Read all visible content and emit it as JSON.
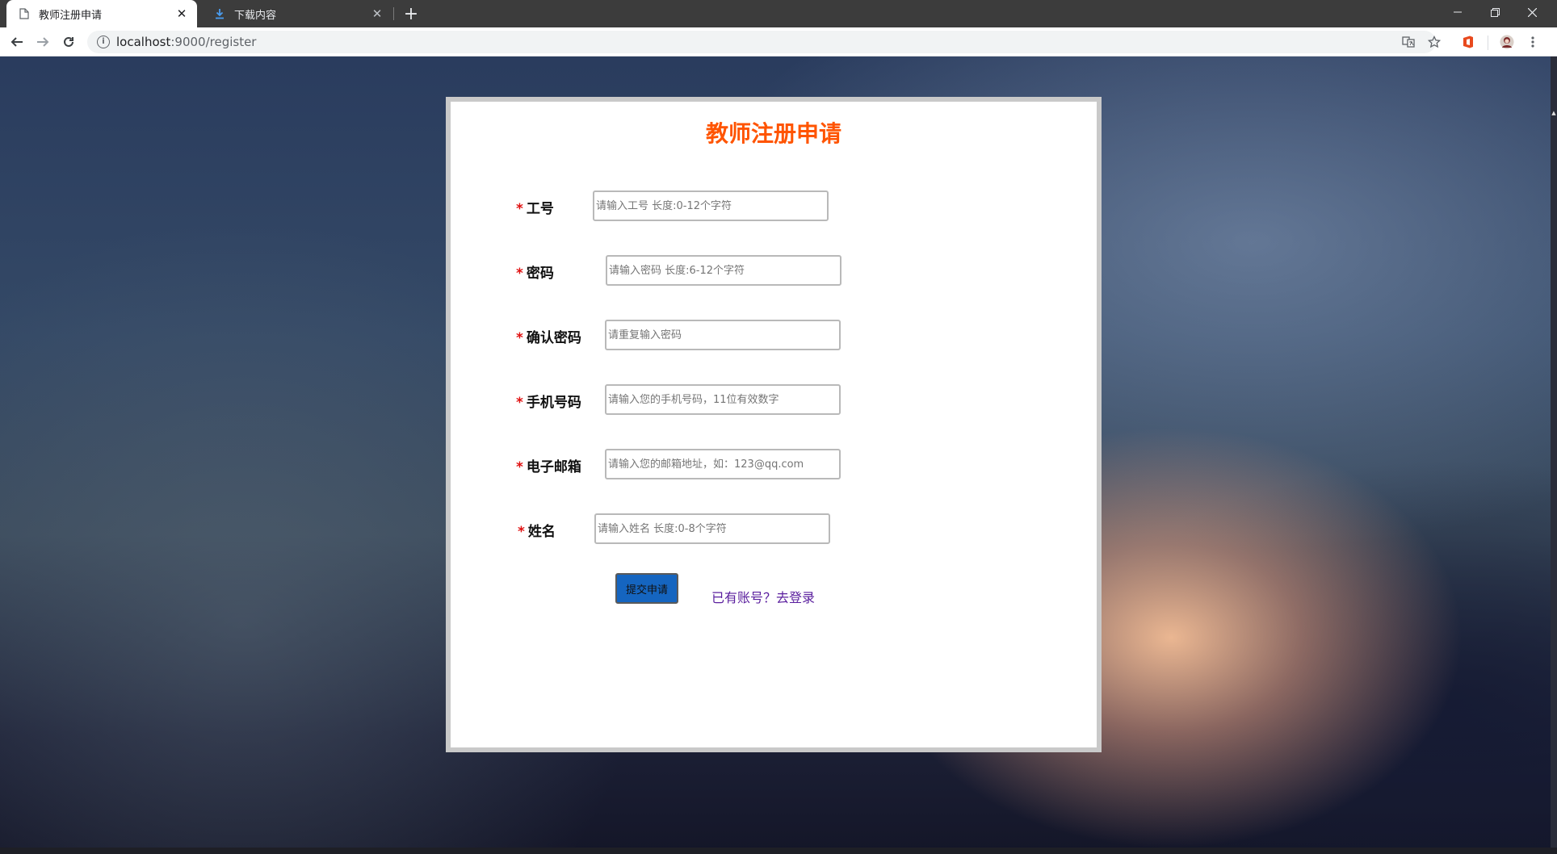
{
  "browser": {
    "tabs": [
      {
        "title": "教师注册申请",
        "active": true
      },
      {
        "title": "下载内容",
        "active": false
      }
    ],
    "url_host": "localhost",
    "url_path": ":9000/register"
  },
  "form": {
    "title": "教师注册申请",
    "required_mark": "*",
    "fields": [
      {
        "label": "工号",
        "placeholder": "请输入工号 长度:0-12个字符"
      },
      {
        "label": "密码",
        "placeholder": "请输入密码 长度:6-12个字符"
      },
      {
        "label": "确认密码",
        "placeholder": "请重复输入密码"
      },
      {
        "label": "手机号码",
        "placeholder": "请输入您的手机号码，11位有效数字"
      },
      {
        "label": "电子邮箱",
        "placeholder": "请输入您的邮箱地址，如：123@qq.com"
      },
      {
        "label": "姓名",
        "placeholder": "请输入姓名 长度:0-8个字符"
      }
    ],
    "submit_label": "提交申请",
    "login_link": "已有账号？去登录"
  },
  "colors": {
    "title": "#ff5400",
    "required": "#e01010",
    "submit_button": "#1565c0",
    "link": "#5a1e9e"
  }
}
